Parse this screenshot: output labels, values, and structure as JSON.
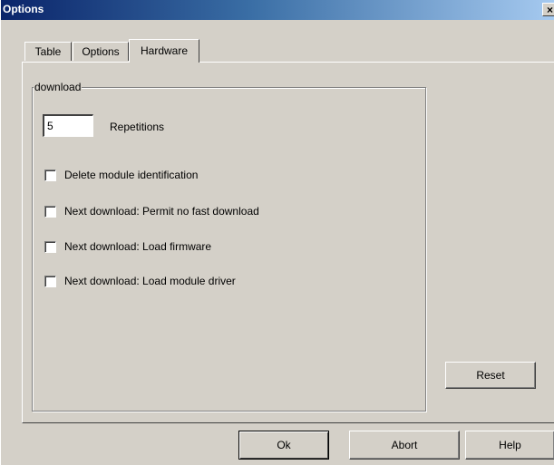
{
  "window": {
    "title": "Options",
    "close_glyph": "×"
  },
  "tabs": [
    {
      "label": "Table",
      "active": false
    },
    {
      "label": "Options",
      "active": false
    },
    {
      "label": "Hardware",
      "active": true
    }
  ],
  "download_group": {
    "legend": "download",
    "repetitions": {
      "value": "5",
      "label": "Repetitions"
    },
    "checkboxes": [
      {
        "label": "Delete module identification",
        "checked": false
      },
      {
        "label": "Next download: Permit no fast download",
        "checked": false
      },
      {
        "label": "Next download: Load firmware",
        "checked": false
      },
      {
        "label": "Next download: Load module driver",
        "checked": false
      }
    ]
  },
  "buttons": {
    "reset": "Reset",
    "ok": "Ok",
    "abort": "Abort",
    "help": "Help"
  },
  "colors": {
    "face": "#d4d0c8",
    "title_start": "#0a246a",
    "title_end": "#a6caf0"
  }
}
